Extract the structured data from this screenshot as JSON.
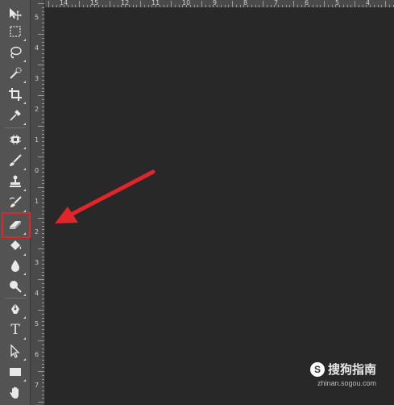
{
  "toolbar": {
    "tools": [
      {
        "name": "move-tool",
        "icon": "move-icon"
      },
      {
        "name": "marquee-tool",
        "icon": "rect-marquee-icon"
      },
      {
        "name": "lasso-tool",
        "icon": "lasso-icon"
      },
      {
        "name": "quick-selection-tool",
        "icon": "quick-selection-icon"
      },
      {
        "name": "crop-tool",
        "icon": "crop-icon"
      },
      {
        "name": "eyedropper-tool",
        "icon": "eyedropper-icon"
      },
      {
        "name": "healing-brush-tool",
        "icon": "bandage-icon"
      },
      {
        "name": "brush-tool",
        "icon": "brush-icon"
      },
      {
        "name": "clone-stamp-tool",
        "icon": "stamp-icon"
      },
      {
        "name": "history-brush-tool",
        "icon": "history-brush-icon"
      },
      {
        "name": "eraser-tool",
        "icon": "eraser-icon",
        "highlighted": true
      },
      {
        "name": "paint-bucket-tool",
        "icon": "paint-bucket-icon"
      },
      {
        "name": "blur-tool",
        "icon": "drop-icon"
      },
      {
        "name": "dodge-tool",
        "icon": "dodge-icon"
      },
      {
        "name": "pen-tool",
        "icon": "pen-icon"
      },
      {
        "name": "type-tool",
        "icon": "type-icon",
        "glyph": "T"
      },
      {
        "name": "path-selection-tool",
        "icon": "direct-selection-icon"
      },
      {
        "name": "rectangle-tool",
        "icon": "rectangle-icon"
      },
      {
        "name": "hand-tool",
        "icon": "hand-icon"
      }
    ],
    "highlight_color": "#e0262a"
  },
  "ruler_top": {
    "labels": [
      "14",
      "15",
      "12",
      "11",
      "10",
      "9",
      "8",
      "7",
      "6",
      "5",
      "4",
      "3",
      "2",
      "1"
    ]
  },
  "ruler_left": {
    "labels": [
      "5",
      "4",
      "3",
      "2",
      "1",
      "0",
      "1",
      "2",
      "3",
      "4",
      "5",
      "6",
      "7"
    ]
  },
  "annotation": {
    "arrow_color": "#e0262a",
    "target": "eraser-tool"
  },
  "watermark": {
    "logo_letter": "S",
    "text": "搜狗指南",
    "url": "zhinan.sogou.com"
  },
  "colors": {
    "canvas": "#282828",
    "panel": "#535353",
    "ruler": "#4a4a4a"
  }
}
